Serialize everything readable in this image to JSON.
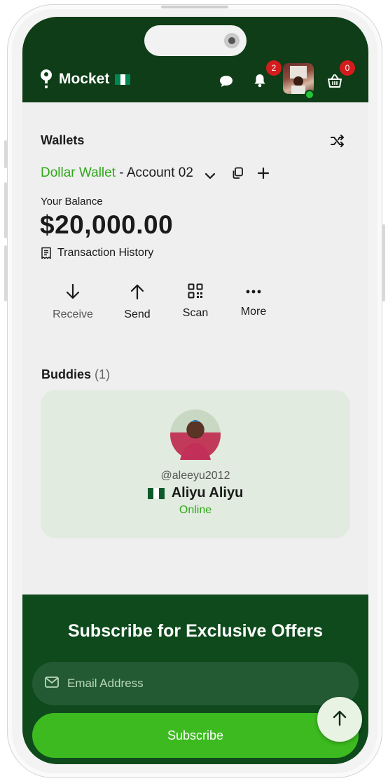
{
  "app": {
    "brand": "Mocket"
  },
  "header": {
    "notifications_count": "2",
    "cart_count": "0",
    "flag_colors": [
      "#008751",
      "#ffffff",
      "#008751"
    ]
  },
  "wallets": {
    "title": "Wallets",
    "wallet_name": "Dollar Wallet",
    "separator": " - ",
    "account_label": "Account 02",
    "balance_label": "Your Balance",
    "balance": "$20,000.00",
    "history_label": "Transaction History"
  },
  "actions": [
    {
      "label": "Receive",
      "icon": "arrow-down-icon"
    },
    {
      "label": "Send",
      "icon": "arrow-up-icon"
    },
    {
      "label": "Scan",
      "icon": "qr-code-icon"
    },
    {
      "label": "More",
      "icon": "more-dots-icon"
    }
  ],
  "buddies": {
    "title": "Buddies",
    "count": "(1)",
    "items": [
      {
        "handle": "@aleeyu2012",
        "name": "Aliyu Aliyu",
        "status": "Online"
      }
    ]
  },
  "subscribe": {
    "title": "Subscribe for Exclusive Offers",
    "email_placeholder": "Email Address",
    "button_label": "Subscribe"
  },
  "colors": {
    "brand_dark": "#0e3d17",
    "accent_green": "#3cba1f",
    "wallet_link": "#2fa81a",
    "online_green": "#2fa81a",
    "badge_red": "#d31c1c"
  }
}
